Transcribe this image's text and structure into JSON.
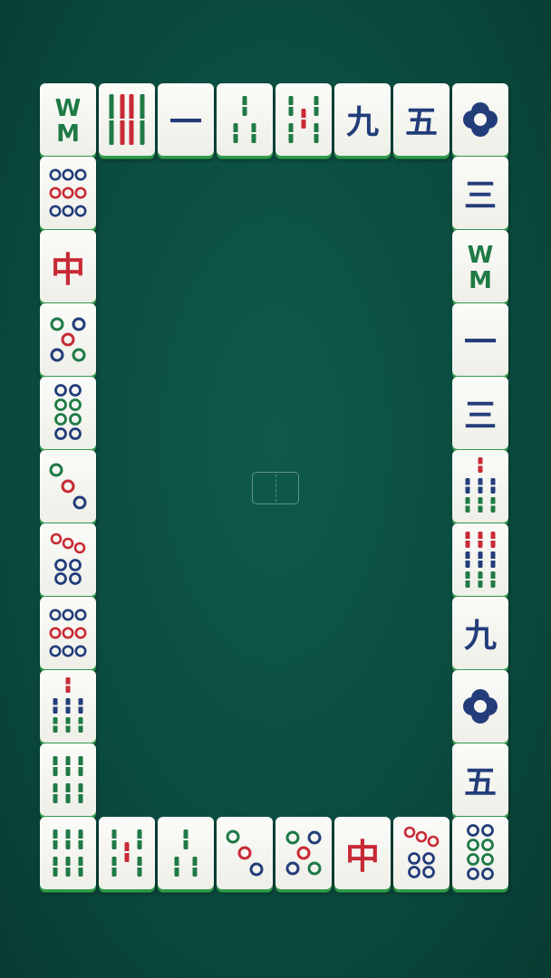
{
  "colors": {
    "felt": "#0b4c40",
    "tile_face": "#f7f7f3",
    "tile_edge": "#2f9a4c",
    "blue": "#233d7a",
    "red": "#c82a35",
    "green": "#1f7a45"
  },
  "center_slot": "empty-slot",
  "tiles": {
    "top": [
      {
        "kind": "honor",
        "value": "green-dragon"
      },
      {
        "kind": "bamboo",
        "value": "8"
      },
      {
        "kind": "char",
        "value": "一"
      },
      {
        "kind": "bamboo",
        "value": "3"
      },
      {
        "kind": "bamboo",
        "value": "5"
      },
      {
        "kind": "char",
        "value": "九"
      },
      {
        "kind": "char",
        "value": "五"
      },
      {
        "kind": "dots",
        "value": "1"
      }
    ],
    "left": [
      {
        "kind": "dots",
        "value": "9"
      },
      {
        "kind": "honor",
        "value": "red-dragon",
        "text": "中"
      },
      {
        "kind": "dots",
        "value": "5"
      },
      {
        "kind": "dots",
        "value": "8"
      },
      {
        "kind": "dots",
        "value": "3"
      },
      {
        "kind": "dots",
        "value": "7"
      },
      {
        "kind": "dots",
        "value": "9"
      },
      {
        "kind": "bamboo",
        "value": "7"
      },
      {
        "kind": "bamboo",
        "value": "6"
      }
    ],
    "right": [
      {
        "kind": "char",
        "value": "三"
      },
      {
        "kind": "honor",
        "value": "green-dragon"
      },
      {
        "kind": "char",
        "value": "一"
      },
      {
        "kind": "char",
        "value": "三"
      },
      {
        "kind": "bamboo",
        "value": "7"
      },
      {
        "kind": "bamboo",
        "value": "9"
      },
      {
        "kind": "char",
        "value": "九"
      },
      {
        "kind": "dots",
        "value": "1"
      },
      {
        "kind": "char",
        "value": "五"
      }
    ],
    "bottom": [
      {
        "kind": "bamboo",
        "value": "6"
      },
      {
        "kind": "bamboo",
        "value": "5"
      },
      {
        "kind": "bamboo",
        "value": "3"
      },
      {
        "kind": "dots",
        "value": "3"
      },
      {
        "kind": "dots",
        "value": "5"
      },
      {
        "kind": "honor",
        "value": "red-dragon",
        "text": "中"
      },
      {
        "kind": "dots",
        "value": "7"
      },
      {
        "kind": "dots",
        "value": "8"
      }
    ]
  }
}
